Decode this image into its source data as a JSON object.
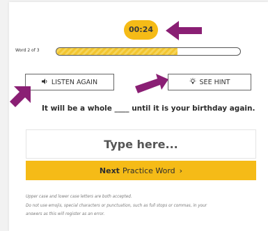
{
  "timer": {
    "text": "00:24",
    "color": "#f5bb17"
  },
  "progress": {
    "label": "Word 2 of 3",
    "fraction": 0.66,
    "fill_color": "#f2c530"
  },
  "buttons": {
    "listen_icon": "speaker-icon",
    "listen_label": "LISTEN AGAIN",
    "hint_icon": "lightbulb-icon",
    "hint_label": "SEE HINT"
  },
  "sentence": "It will be a whole ____ until it is your birthday again.",
  "answer": {
    "placeholder": "Type here...",
    "value": ""
  },
  "next": {
    "bold": "Next",
    "rest": "Practice Word",
    "chevron": "›",
    "color": "#f5bb17"
  },
  "notes": [
    "Upper case and lower case letters are both accepted.",
    "Do not use emojis, special characters or punctuation, such as full stops or commas, in your",
    "answers as this will register as an error."
  ],
  "annotation_color": "#8a1f74"
}
